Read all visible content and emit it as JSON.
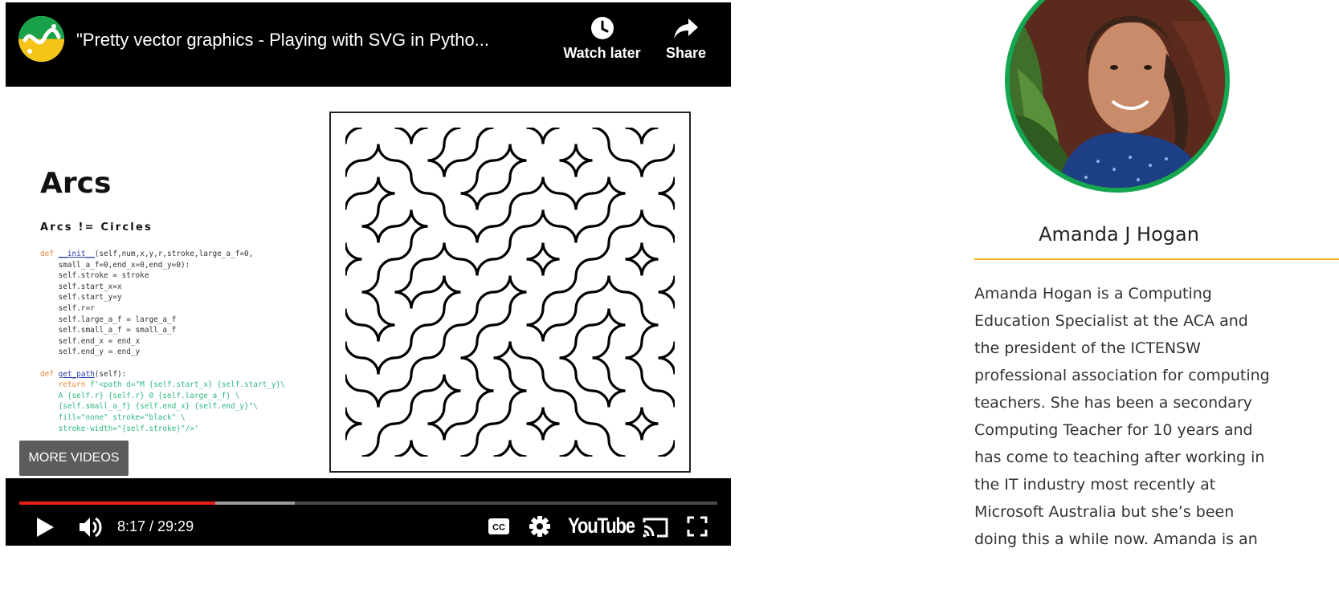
{
  "player": {
    "title": "\"Pretty vector graphics - Playing with SVG in Pytho...",
    "watch_later_label": "Watch later",
    "share_label": "Share",
    "more_videos_label": "MORE VIDEOS",
    "time_display": "8:17 / 29:29",
    "played_fraction": 0.281,
    "buffered_fraction": 0.395,
    "brand": "YouTube",
    "colors": {
      "progress": "#e62117",
      "buffer": "#9c9c9c",
      "background": "#000000"
    },
    "icons": [
      "channel-logo",
      "clock-icon",
      "share-arrow-icon",
      "play-icon",
      "volume-icon",
      "captions-icon",
      "settings-gear-icon",
      "cast-icon",
      "fullscreen-icon"
    ]
  },
  "slide": {
    "title": "Arcs",
    "subtitle": "Arcs != Circles",
    "code_lines": [
      "def __init__(self,num,x,y,r,stroke,large_a_f=0,",
      "    small_a_f=0,end_x=0,end_y=0):",
      "    self.stroke = stroke",
      "    self.start_x=x",
      "    self.start_y=y",
      "    self.r=r",
      "    self.large_a_f = large_a_f",
      "    self.small_a_f = small_a_f",
      "    self.end_x = end_x",
      "    self.end_y = end_y",
      "",
      "def get_path(self):",
      "    return f'<path d=\"M {self.start_x} {self.start_y}\\",
      "    A {self.r} {self.r} 0 {self.large_a_f} \\",
      "    {self.small_a_f} {self.end_x} {self.end_y}\"\\",
      "    fill=\"none\" stroke=\"black\" \\",
      "    stroke-width=\"{self.stroke}\"/>'"
    ]
  },
  "speaker": {
    "name": "Amanda J Hogan",
    "bio_lines": [
      "Amanda Hogan is a Computing",
      "Education Specialist at the ACA and",
      "the president of the ICTENSW",
      "professional association for computing",
      "teachers. She has been a secondary",
      "Computing Teacher for 10 years and",
      "has come to teaching after working in",
      "the IT industry most recently at",
      "Microsoft Australia but she’s been",
      "doing this a while now. Amanda is an"
    ],
    "colors": {
      "avatar_ring": "#14a650",
      "rule": "#f5b326"
    }
  }
}
